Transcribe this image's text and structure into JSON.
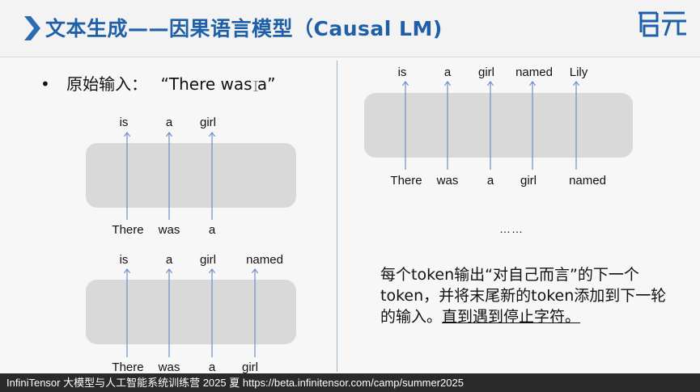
{
  "header": {
    "title": "文本生成——因果语言模型（Causal LM)",
    "logo_text": "启元"
  },
  "left": {
    "bullet_prefix": "•",
    "bullet_label": "原始输入：",
    "bullet_quote": "“There was a”",
    "diagram1": {
      "outputs": [
        "is",
        "a",
        "girl"
      ],
      "inputs": [
        "There",
        "was",
        "a"
      ]
    },
    "diagram2": {
      "outputs": [
        "is",
        "a",
        "girl",
        "named"
      ],
      "inputs": [
        "There",
        "was",
        "a",
        "girl"
      ]
    }
  },
  "right": {
    "diagram3": {
      "outputs": [
        "is",
        "a",
        "girl",
        "named",
        "Lily"
      ],
      "inputs": [
        "There",
        "was",
        "a",
        "girl",
        "named"
      ]
    },
    "ellipsis": "……",
    "description_plain": "每个token输出“对自己而言”的下一个token，并将末尾新的token添加到下一轮的输入。",
    "description_underlined": "直到遇到停止字符。"
  },
  "footer": {
    "text": "InfiniTensor 大模型与人工智能系统训练营 2025 夏    https://beta.infinitensor.com/camp/summer2025"
  },
  "colors": {
    "title": "#1e5fa8",
    "arrow": "#6d8fc4",
    "box": "#d9d9d9",
    "footer_bg": "#2a2a2a"
  }
}
